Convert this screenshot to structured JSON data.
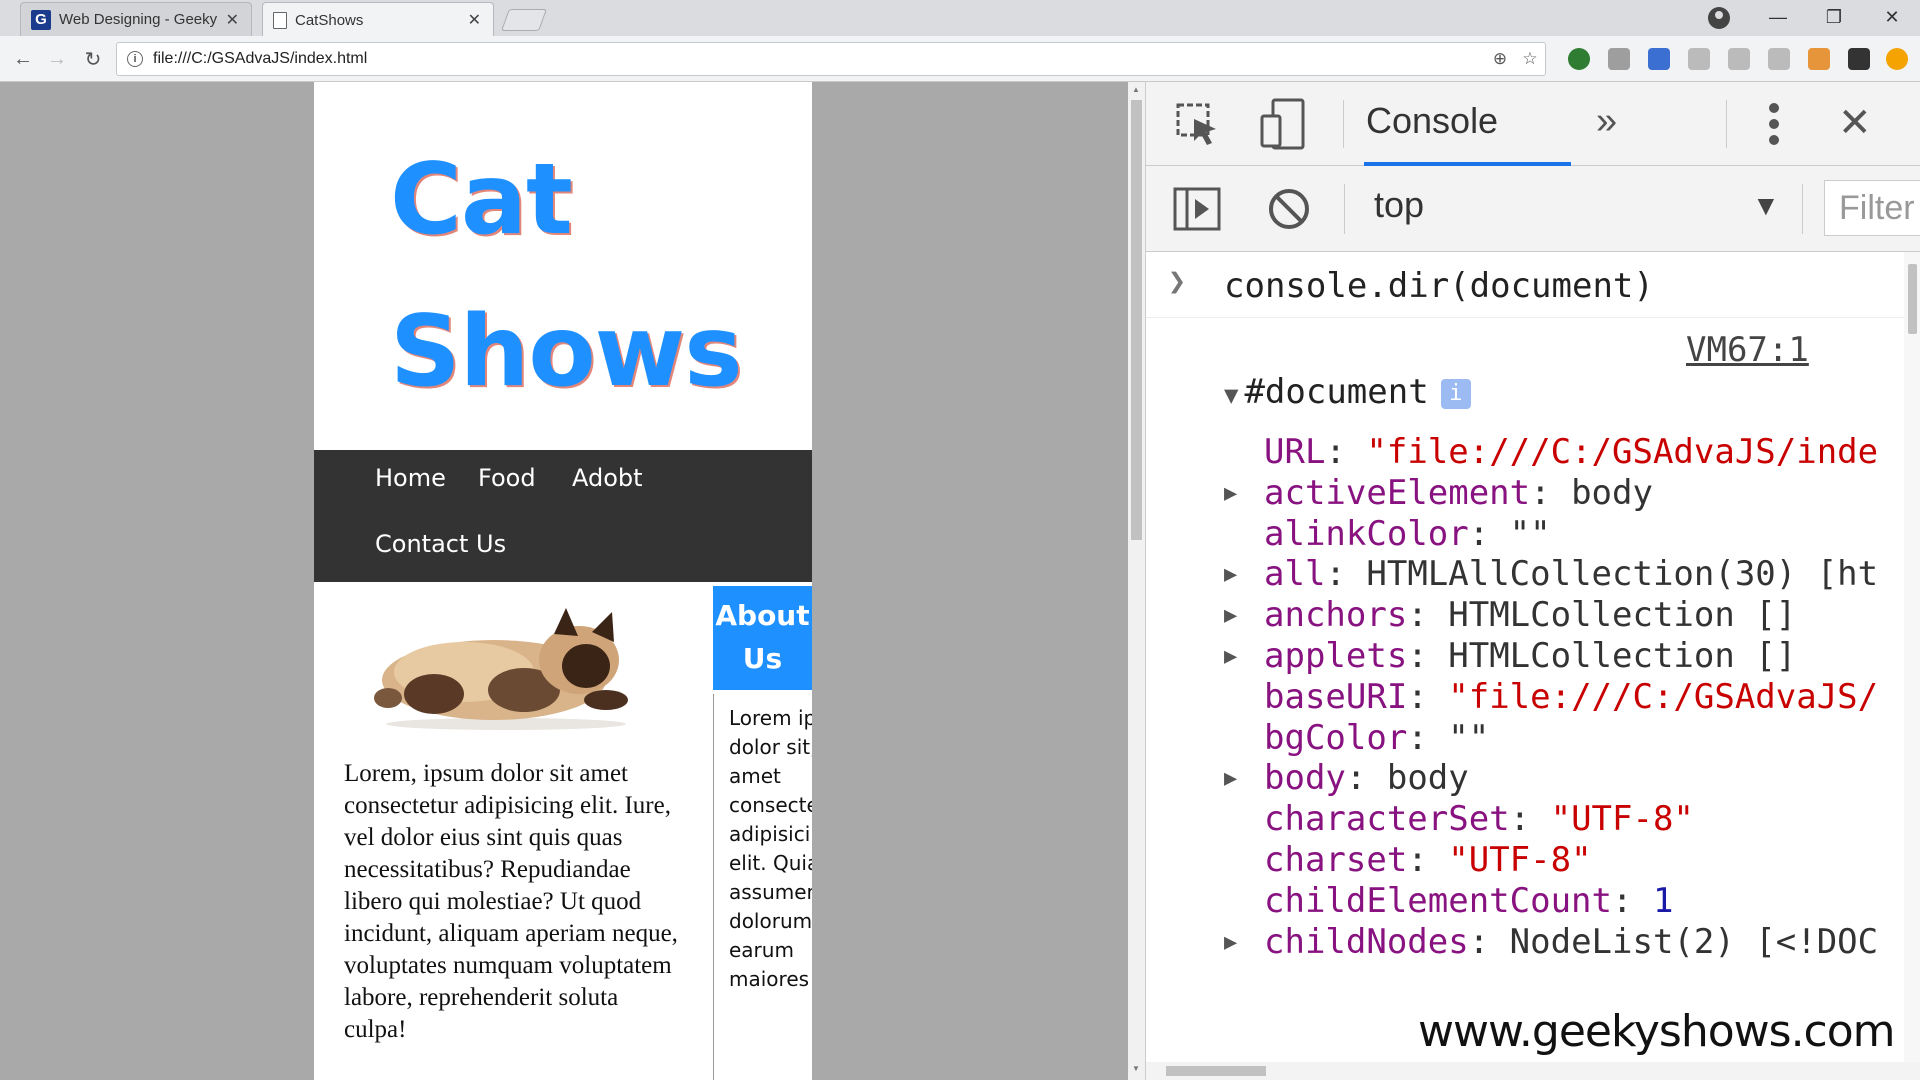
{
  "browser": {
    "tabs": [
      {
        "title": "Web Designing - Geeky S",
        "favicon": "G",
        "active": false
      },
      {
        "title": "CatShows",
        "active": true
      }
    ],
    "address": "file:///C:/GSAdvaJS/index.html",
    "nav_icons": [
      "back-arrow-icon",
      "forward-arrow-icon",
      "reload-icon"
    ],
    "omnibox_icons": [
      "zoom-icon",
      "bookmark-star-icon"
    ],
    "window_controls": [
      "minimize-icon",
      "restore-icon",
      "close-icon"
    ]
  },
  "site": {
    "title_line1": "Cat",
    "title_line2": "Shows",
    "nav": [
      "Home",
      "Food",
      "Adobt",
      "Contact Us"
    ],
    "main_text": "Lorem, ipsum dolor sit amet consectetur adipisicing elit. Iure, vel dolor eius sint quis quas necessitatibus? Repudiandae libero qui molestiae? Ut quod incidunt, aliquam aperiam neque, voluptates numquam voluptatem labore, reprehenderit soluta culpa!",
    "about_title": "About Us",
    "about_text": "Lorem ipsum dolor sit, amet consectetur adipisicing elit. Quia assumenda, dolorum earum maiores",
    "colors": {
      "accent": "#1e90ff",
      "title_shadow": "#e3867a",
      "nav_bg": "#333333"
    }
  },
  "devtools": {
    "active_tab": "Console",
    "more_tabs": "»",
    "context": "top",
    "filter_placeholder": "Filter",
    "command": "console.dir(document)",
    "source_link": "VM67:1",
    "object_label": "#document",
    "info_badge": "i",
    "properties": [
      {
        "key": "URL",
        "value": "\"file:///C:/GSAdvaJS/inde",
        "type": "string",
        "expandable": false
      },
      {
        "key": "activeElement",
        "value": "body",
        "type": "object",
        "expandable": true
      },
      {
        "key": "alinkColor",
        "value": "\"\"",
        "type": "plain",
        "expandable": false
      },
      {
        "key": "all",
        "value": "HTMLAllCollection(30) [ht",
        "type": "object",
        "expandable": true
      },
      {
        "key": "anchors",
        "value": "HTMLCollection []",
        "type": "object",
        "expandable": true
      },
      {
        "key": "applets",
        "value": "HTMLCollection []",
        "type": "object",
        "expandable": true
      },
      {
        "key": "baseURI",
        "value": "\"file:///C:/GSAdvaJS/",
        "type": "string",
        "expandable": false
      },
      {
        "key": "bgColor",
        "value": "\"\"",
        "type": "plain",
        "expandable": false
      },
      {
        "key": "body",
        "value": "body",
        "type": "object",
        "expandable": true
      },
      {
        "key": "characterSet",
        "value": "\"UTF-8\"",
        "type": "string",
        "expandable": false
      },
      {
        "key": "charset",
        "value": "\"UTF-8\"",
        "type": "string",
        "expandable": false
      },
      {
        "key": "childElementCount",
        "value": "1",
        "type": "number",
        "expandable": false
      },
      {
        "key": "childNodes",
        "value": "NodeList(2) [<!DOC",
        "type": "object",
        "expandable": true
      }
    ]
  },
  "watermark": "www.geekyshows.com"
}
